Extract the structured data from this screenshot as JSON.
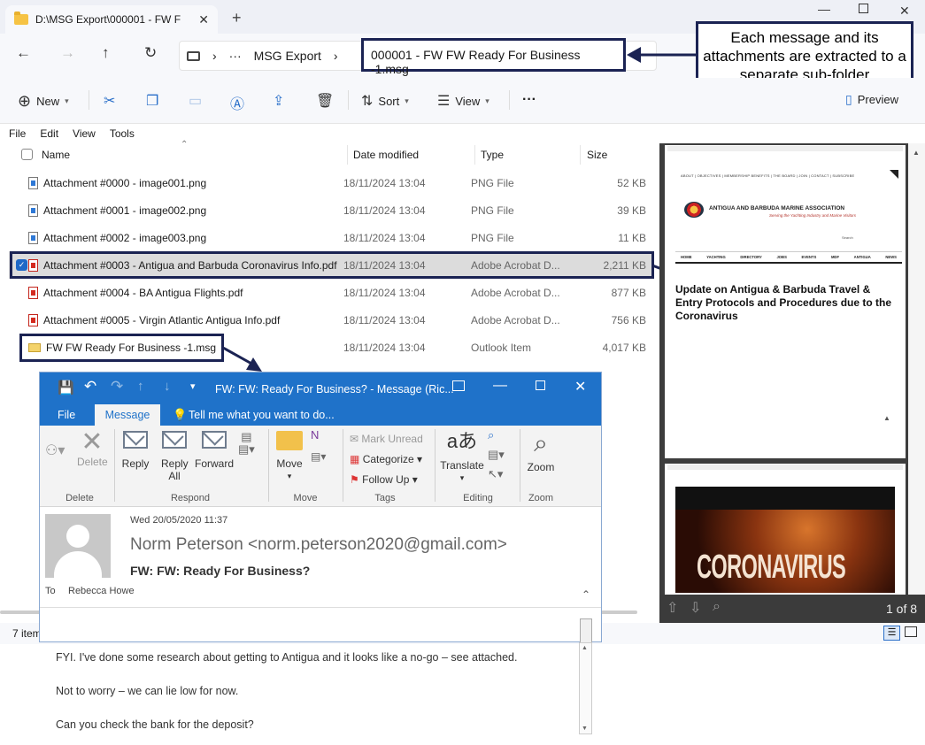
{
  "explorer": {
    "tab_title": "D:\\MSG Export\\000001 - FW  F",
    "breadcrumb": {
      "ellipsis": "···",
      "parent": "MSG Export",
      "current": "000001 - FW  FW  Ready For Business -1.msg"
    },
    "toolbar": {
      "new_label": "New",
      "sort_label": "Sort",
      "view_label": "View",
      "more_label": "···",
      "preview_label": "Preview"
    },
    "menu": [
      "File",
      "Edit",
      "View",
      "Tools"
    ],
    "columns": {
      "name": "Name",
      "date": "Date modified",
      "type": "Type",
      "size": "Size"
    },
    "files": [
      {
        "name": "Attachment #0000 - image001.png",
        "date": "18/11/2024 13:04",
        "type": "PNG File",
        "size": "52 KB",
        "kind": "png"
      },
      {
        "name": "Attachment #0001 - image002.png",
        "date": "18/11/2024 13:04",
        "type": "PNG File",
        "size": "39 KB",
        "kind": "png"
      },
      {
        "name": "Attachment #0002 - image003.png",
        "date": "18/11/2024 13:04",
        "type": "PNG File",
        "size": "11 KB",
        "kind": "png"
      },
      {
        "name": "Attachment #0003 - Antigua and Barbuda Coronavirus Info.pdf",
        "date": "18/11/2024 13:04",
        "type": "Adobe Acrobat D...",
        "size": "2,211 KB",
        "kind": "pdf"
      },
      {
        "name": "Attachment #0004 - BA Antigua Flights.pdf",
        "date": "18/11/2024 13:04",
        "type": "Adobe Acrobat D...",
        "size": "877 KB",
        "kind": "pdf"
      },
      {
        "name": "Attachment #0005 - Virgin Atlantic Antigua Info.pdf",
        "date": "18/11/2024 13:04",
        "type": "Adobe Acrobat D...",
        "size": "756 KB",
        "kind": "pdf"
      },
      {
        "name": "FW  FW  Ready For Business -1.msg",
        "date": "18/11/2024 13:04",
        "type": "Outlook Item",
        "size": "4,017 KB",
        "kind": "msg"
      }
    ],
    "status_count": "7 item",
    "callout": "Each message and its attachments are extracted to a separate sub-folder"
  },
  "preview": {
    "org_name": "ANTIGUA AND BARBUDA MARINE ASSOCIATION",
    "org_tagline": "Serving the Yachting Industry and Marine Visitors",
    "nav": [
      "HOME",
      "YACHTING",
      "DIRECTORY",
      "JOBS",
      "EVENTS",
      "MDF",
      "ANTIGUA",
      "NEWS"
    ],
    "top_links": "ABOUT | OBJECTIVES | MEMBERSHIP BENEFITS | THE BOARD | JOIN | CONTACT | SUBSCRIBE",
    "search": "Search",
    "headline": "Update on Antigua & Barbuda Travel & Entry Protocols and Procedures due to the Coronavirus",
    "banner": "CORONAVIRUS",
    "page_counter": "1 of 8"
  },
  "outlook": {
    "title": "FW: FW: Ready For Business? - Message (Ric...",
    "tabs": {
      "file": "File",
      "message": "Message",
      "tell": "Tell me what you want to do..."
    },
    "ribbon": {
      "delete": "Delete",
      "reply": "Reply",
      "reply_all": "Reply All",
      "forward": "Forward",
      "move": "Move",
      "mark_unread": "Mark Unread",
      "categorize": "Categorize",
      "follow_up": "Follow Up",
      "translate": "Translate",
      "zoom": "Zoom",
      "groups": [
        "Delete",
        "Respond",
        "Move",
        "Tags",
        "Editing",
        "Zoom"
      ]
    },
    "date": "Wed 20/05/2020 11:37",
    "sender": "Norm Peterson <norm.peterson2020@gmail.com>",
    "subject": "FW: FW: Ready For Business?",
    "to_label": "To",
    "to": "Rebecca Howe",
    "body": [
      "FYI. I've done some research about getting to Antigua and it looks like a no-go – see attached.",
      "Not to worry – we can lie low for now.",
      "Can you check the bank for the deposit?"
    ]
  },
  "colors": {
    "accent": "#1f72c9",
    "callout": "#1b2353",
    "selected_row": "#dcdcdc"
  }
}
